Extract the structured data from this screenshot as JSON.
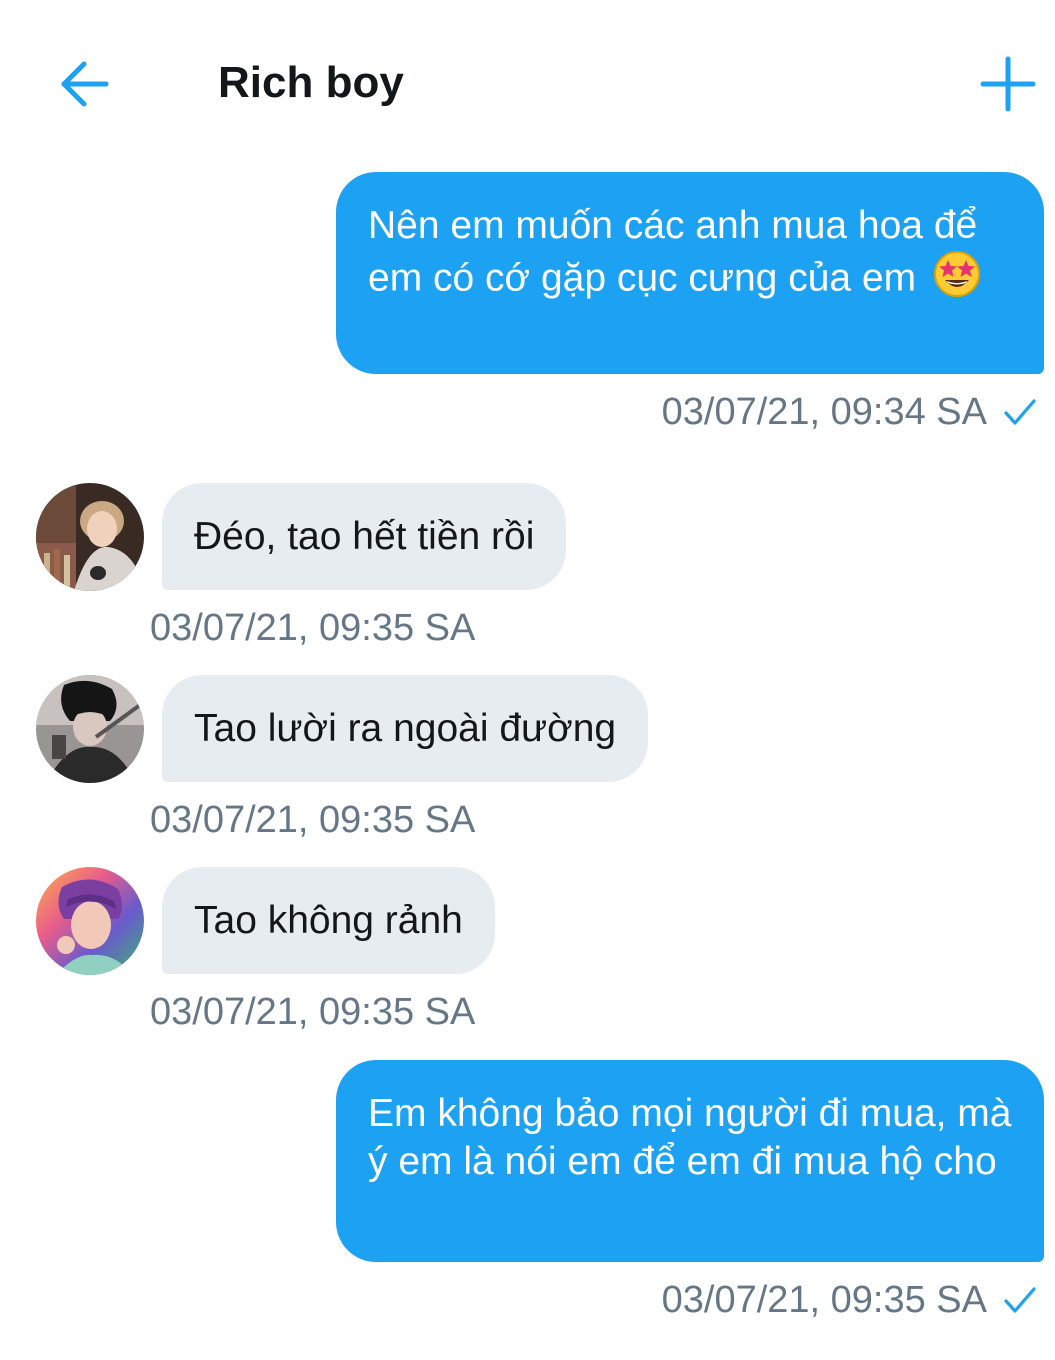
{
  "header": {
    "title": "Rich boy",
    "back_icon": "arrow-left-icon",
    "add_icon": "plus-icon",
    "accent_color": "#1da1f2"
  },
  "messages": [
    {
      "direction": "sent",
      "text": "Nên em muốn các anh mua hoa để em có cớ gặp cục cưng của em",
      "emoji": "star-struck-emoji",
      "timestamp": "03/07/21, 09:34 SA",
      "status_icon": "check-icon"
    },
    {
      "direction": "received",
      "text": "Đéo, tao hết tiền rồi",
      "timestamp": "03/07/21, 09:35 SA",
      "avatar": "avatar-photo-1"
    },
    {
      "direction": "received",
      "text": "Tao lười ra ngoài đường",
      "timestamp": "03/07/21, 09:35 SA",
      "avatar": "avatar-photo-2"
    },
    {
      "direction": "received",
      "text": "Tao không rảnh",
      "timestamp": "03/07/21, 09:35 SA",
      "avatar": "avatar-photo-3"
    },
    {
      "direction": "sent",
      "text": "Em không bảo mọi người đi mua, mà ý em là nói em để em đi mua hộ cho",
      "timestamp": "03/07/21, 09:35 SA",
      "status_icon": "check-icon"
    }
  ]
}
